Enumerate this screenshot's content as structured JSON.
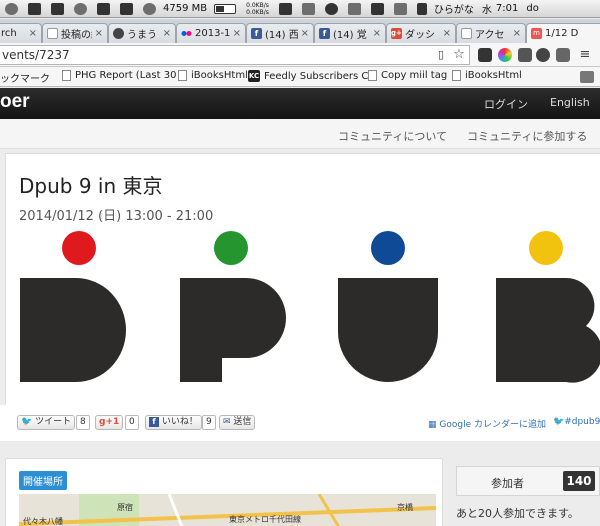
{
  "menubar": {
    "memory": "4759 MB",
    "net_up": "0.0KB/s",
    "net_down": "0.0KB/s",
    "input_method": "ひらがな",
    "day": "水",
    "time": "7:01",
    "trailing": "do"
  },
  "tabs": [
    {
      "label": "rch",
      "icon": "doc-icon"
    },
    {
      "label": "投稿の編",
      "icon": "doc-icon"
    },
    {
      "label": "うまう",
      "icon": "character-icon"
    },
    {
      "label": "2013-1",
      "icon": "flickr-icon"
    },
    {
      "label": "(14) 西",
      "icon": "facebook-icon"
    },
    {
      "label": "(14) 覚",
      "icon": "facebook-icon"
    },
    {
      "label": "ダッシ",
      "icon": "googleplus-icon"
    },
    {
      "label": "アクセ",
      "icon": "doc-icon"
    },
    {
      "label": "1/12 D",
      "icon": "meetup-icon"
    }
  ],
  "address": {
    "url": "vents/7237"
  },
  "bookmarks": [
    {
      "label": "ックマーク",
      "icon": "none"
    },
    {
      "label": "PHG Report (Last 30",
      "icon": "doc-icon"
    },
    {
      "label": "iBooksHtml",
      "icon": "doc-icon"
    },
    {
      "label": "Feedly Subscribers C",
      "icon": "kc-icon"
    },
    {
      "label": "Copy miil tag",
      "icon": "doc-icon"
    },
    {
      "label": "iBooksHtml",
      "icon": "doc-icon"
    }
  ],
  "site": {
    "brand": "oer",
    "login": "ログイン",
    "language": "English",
    "nav_about": "コミュニティについて",
    "nav_join": "コミュニティに参加する"
  },
  "event": {
    "title": "Dpub 9 in 東京",
    "datetime": "2014/01/12 (日) 13:00 - 21:00"
  },
  "logo_colors": {
    "dot1": "#e0191f",
    "dot2": "#25952f",
    "dot3": "#0f4a97",
    "dot4": "#f1c30e",
    "letters": "#2d2a2a"
  },
  "social": {
    "tweet": "ツイート",
    "tweet_count": "8",
    "gplus": "+1",
    "gplus_count": "0",
    "like": "いいね！",
    "like_count": "9",
    "send": "送信",
    "calendar": "Google カレンダーに追加",
    "hashtag": "#dpub9"
  },
  "venue": {
    "badge": "開催場所",
    "map_labels": [
      "代々木八幡",
      "原宿",
      "東京メトロ千代田線",
      "京橋"
    ]
  },
  "participants": {
    "label": "参加者",
    "count": "140",
    "remaining": "あと20人参加できます。"
  }
}
